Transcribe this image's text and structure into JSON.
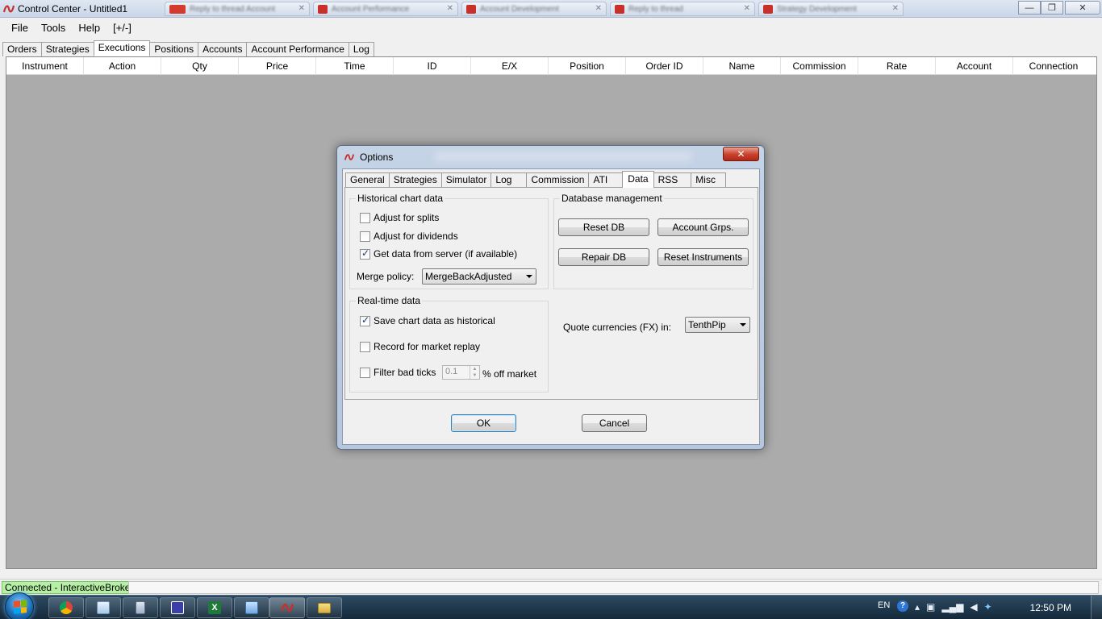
{
  "window": {
    "title": "Control Center - Untitled1",
    "controls": {
      "minimize": "—",
      "maximize": "❐",
      "close": "✕"
    }
  },
  "browser_tabs": [
    {
      "label": "Reply to thread Account"
    },
    {
      "label": "Account Performance"
    },
    {
      "label": "Account Development"
    },
    {
      "label": "Reply to thread"
    },
    {
      "label": "Strategy Development"
    }
  ],
  "menu": [
    "File",
    "Tools",
    "Help",
    "[+/-]"
  ],
  "main_tabs": {
    "items": [
      "Orders",
      "Strategies",
      "Executions",
      "Positions",
      "Accounts",
      "Account Performance",
      "Log"
    ],
    "active": "Executions"
  },
  "grid": {
    "columns": [
      "Instrument",
      "Action",
      "Qty",
      "Price",
      "Time",
      "ID",
      "E/X",
      "Position",
      "Order ID",
      "Name",
      "Commission",
      "Rate",
      "Account",
      "Connection"
    ]
  },
  "status": {
    "connection": "Connected - InteractiveBrokers"
  },
  "dialog": {
    "title": "Options",
    "close_label": "✕",
    "tabs": [
      "General",
      "Strategies",
      "Simulator",
      "Log",
      "Commission",
      "ATI",
      "Data",
      "RSS",
      "Misc"
    ],
    "active_tab": "Data",
    "historical": {
      "title": "Historical chart data",
      "adjust_splits": {
        "label": "Adjust for splits",
        "checked": false
      },
      "adjust_dividends": {
        "label": "Adjust for dividends",
        "checked": false
      },
      "get_from_server": {
        "label": "Get data from server (if available)",
        "checked": true
      },
      "merge_label": "Merge policy:",
      "merge_value": "MergeBackAdjusted"
    },
    "database": {
      "title": "Database management",
      "reset_db": "Reset DB",
      "account_grps": "Account Grps.",
      "repair_db": "Repair DB",
      "reset_instruments": "Reset Instruments"
    },
    "realtime": {
      "title": "Real-time data",
      "save_historical": {
        "label": "Save chart data as historical",
        "checked": true
      },
      "record_replay": {
        "label": "Record for market replay",
        "checked": false
      },
      "filter_bad": {
        "label": "Filter bad ticks",
        "checked": false
      },
      "filter_value": "0.1",
      "filter_suffix": "% off market"
    },
    "quote": {
      "label": "Quote currencies (FX) in:",
      "value": "TenthPip"
    },
    "ok": "OK",
    "cancel": "Cancel"
  },
  "taskbar": {
    "lang": "EN",
    "help": "?",
    "clock": "12:50 PM"
  },
  "colors": {
    "status_connected": "#b6f0a5",
    "grid_bg": "#ababab",
    "brand_red": "#c8302b"
  }
}
